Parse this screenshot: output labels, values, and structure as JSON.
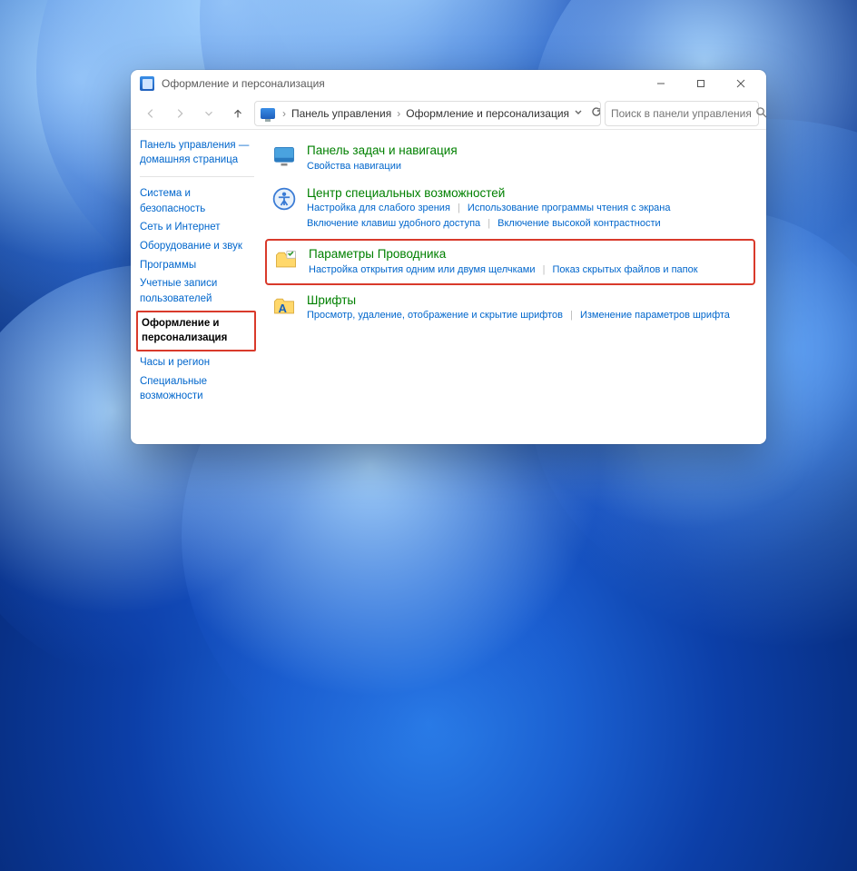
{
  "window": {
    "title": "Оформление и персонализация"
  },
  "breadcrumb": {
    "a": "Панель управления",
    "b": "Оформление и персонализация"
  },
  "search": {
    "placeholder": "Поиск в панели управления"
  },
  "sidebar": {
    "home1": "Панель управления —",
    "home2": "домашняя страница",
    "items": [
      "Система и безопасность",
      "Сеть и Интернет",
      "Оборудование и звук",
      "Программы",
      "Учетные записи пользователей",
      "Оформление и персонализация",
      "Часы и регион",
      "Специальные возможности"
    ]
  },
  "cats": {
    "taskbar": {
      "title": "Панель задач и навигация",
      "l1": "Свойства навигации"
    },
    "ease": {
      "title": "Центр специальных возможностей",
      "l1": "Настройка для слабого зрения",
      "l2": "Использование программы чтения с экрана",
      "l3": "Включение клавиш удобного доступа",
      "l4": "Включение высокой контрастности"
    },
    "explorer": {
      "title": "Параметры Проводника",
      "l1": "Настройка открытия одним или двумя щелчками",
      "l2": "Показ скрытых файлов и папок"
    },
    "fonts": {
      "title": "Шрифты",
      "l1": "Просмотр, удаление, отображение и скрытие шрифтов",
      "l2": "Изменение параметров шрифта"
    }
  }
}
